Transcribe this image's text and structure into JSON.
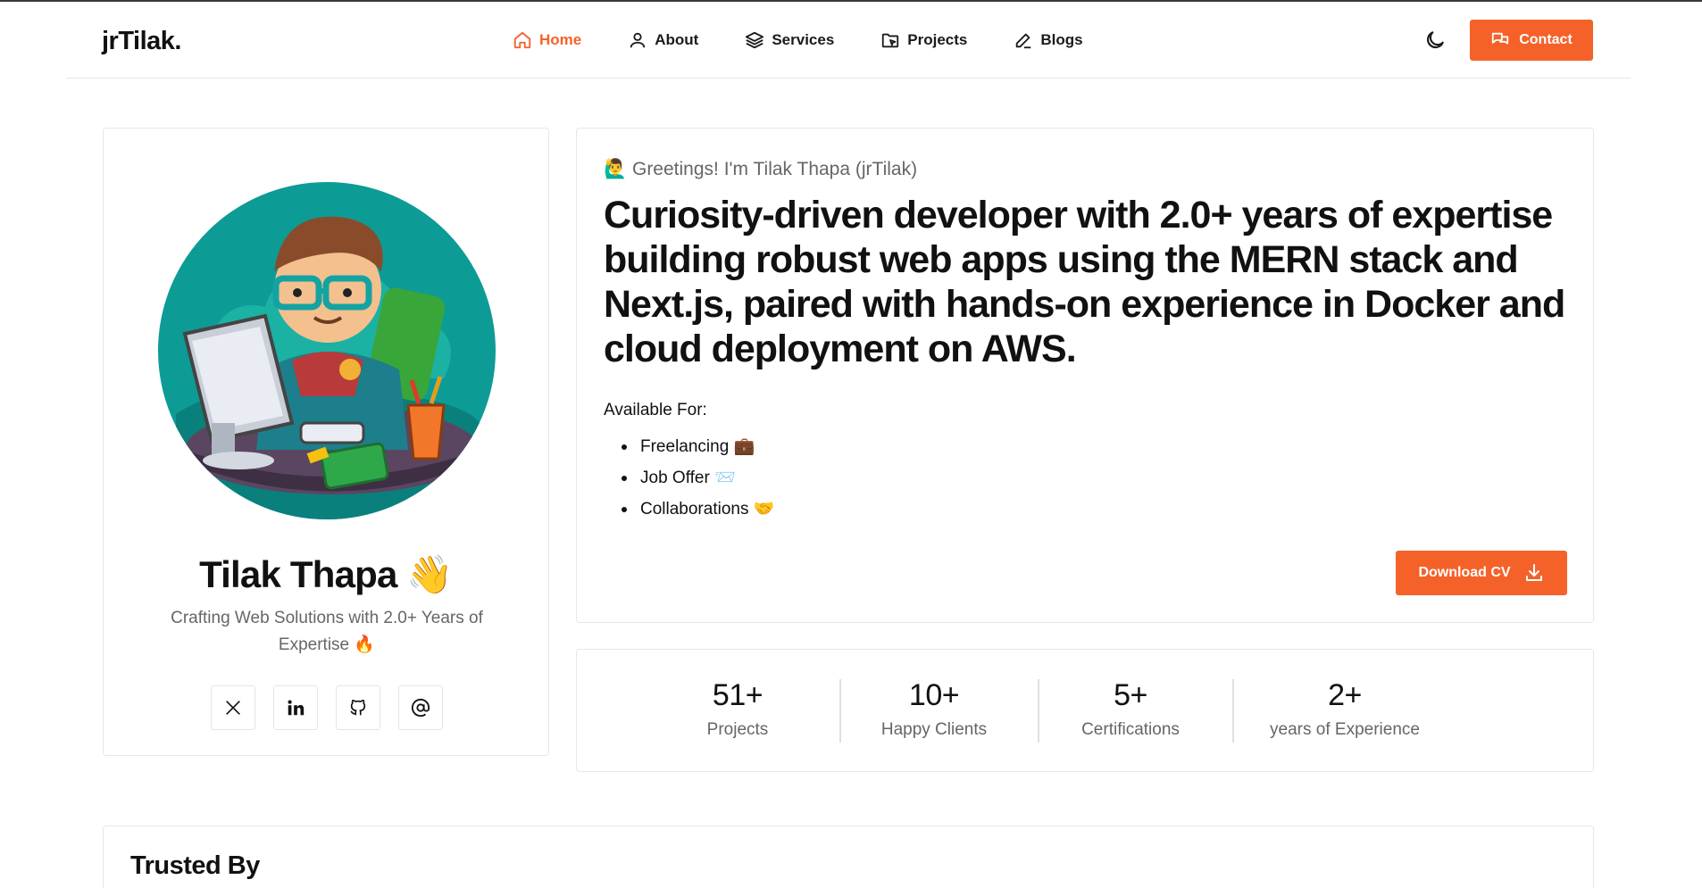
{
  "nav": {
    "logo": "jrTilak.",
    "items": [
      {
        "label": "Home",
        "icon": "home-icon",
        "active": true
      },
      {
        "label": "About",
        "icon": "user-icon",
        "active": false
      },
      {
        "label": "Services",
        "icon": "layers-icon",
        "active": false
      },
      {
        "label": "Projects",
        "icon": "folder-icon",
        "active": false
      },
      {
        "label": "Blogs",
        "icon": "pen-icon",
        "active": false
      }
    ],
    "theme_icon": "moon-icon",
    "contact_label": "Contact"
  },
  "profile": {
    "name": "Tilak Thapa 👋",
    "tagline": "Crafting Web Solutions with 2.0+ Years of Expertise 🔥",
    "socials": [
      "x-icon",
      "linkedin-icon",
      "github-icon",
      "at-icon"
    ]
  },
  "intro": {
    "greeting": "🙋‍♂️ Greetings! I'm Tilak Thapa (jrTilak)",
    "headline": "Curiosity-driven developer with 2.0+ years of expertise building robust web apps using the MERN stack and Next.js, paired with hands-on experience in Docker and cloud deployment on AWS.",
    "available_title": "Available For:",
    "available": [
      "Freelancing 💼",
      "Job Offer 📨",
      "Collaborations 🤝"
    ],
    "download_label": "Download CV"
  },
  "stats": [
    {
      "num": "51+",
      "label": "Projects"
    },
    {
      "num": "10+",
      "label": "Happy Clients"
    },
    {
      "num": "5+",
      "label": "Certifications"
    },
    {
      "num": "2+",
      "label": "years of Experience"
    }
  ],
  "trusted": {
    "title": "Trusted By"
  },
  "colors": {
    "accent": "#f4622a",
    "avatar_bg": "#0d9b96"
  }
}
